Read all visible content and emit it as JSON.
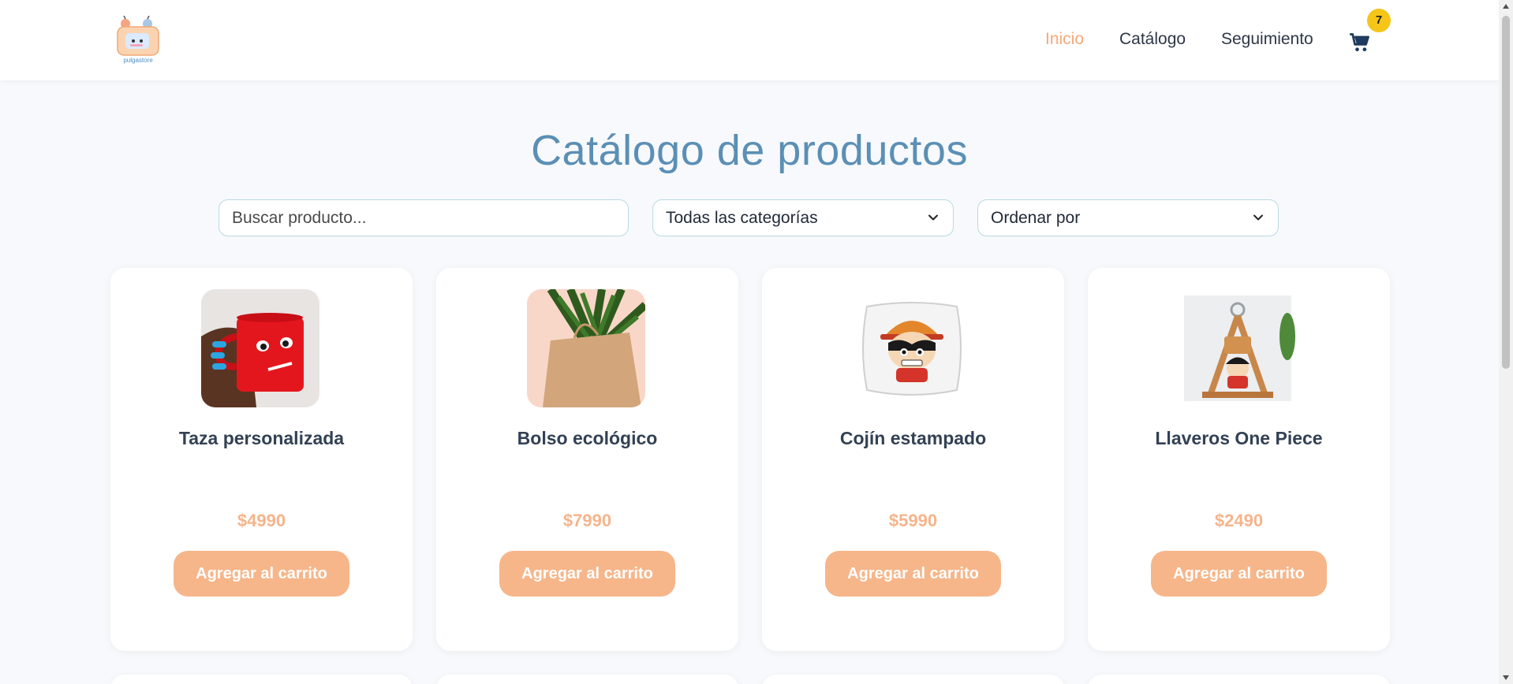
{
  "header": {
    "logo_text": "pulgastore",
    "nav": [
      "Inicio",
      "Catálogo",
      "Seguimiento"
    ],
    "active_nav": "Inicio",
    "cart_count": "7"
  },
  "page_title": "Catálogo de productos",
  "filters": {
    "search_placeholder": "Buscar producto...",
    "category_selected": "Todas las categorías",
    "sort_selected": "Ordenar por"
  },
  "products": [
    {
      "name": "Taza personalizada",
      "price": "$4990",
      "button": "Agregar al carrito",
      "image": "red-mug"
    },
    {
      "name": "Bolso ecológico",
      "price": "$7990",
      "button": "Agregar al carrito",
      "image": "paper-bag"
    },
    {
      "name": "Cojín estampado",
      "price": "$5990",
      "button": "Agregar al carrito",
      "image": "printed-cushion"
    },
    {
      "name": "Llaveros One Piece",
      "price": "$2490",
      "button": "Agregar al carrito",
      "image": "keychain"
    }
  ],
  "colors": {
    "accent": "#f6b68a",
    "title": "#5b8fb5",
    "badge": "#f5c518",
    "text": "#334155"
  }
}
